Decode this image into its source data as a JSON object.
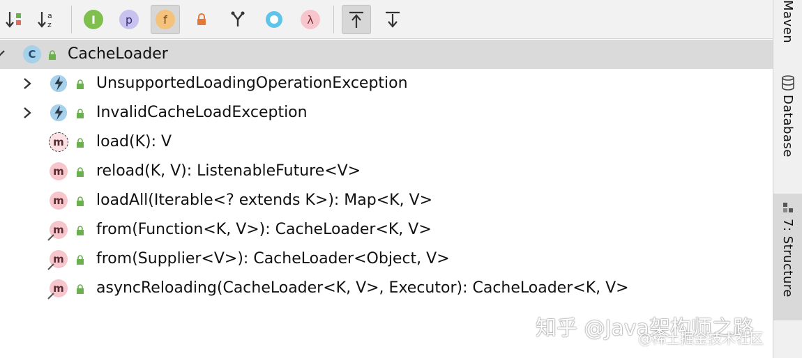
{
  "toolbar": {
    "buttons": [
      {
        "name": "sort-by-visibility-icon"
      },
      {
        "name": "sort-alphabetically-icon",
        "glyph_top": "a",
        "glyph_bottom": "z"
      },
      {
        "name": "show-inherited-icon",
        "glyph": "I"
      },
      {
        "name": "show-properties-icon",
        "glyph": "p"
      },
      {
        "name": "show-fields-icon",
        "glyph": "f"
      },
      {
        "name": "show-non-public-icon"
      },
      {
        "name": "show-anonymous-icon"
      },
      {
        "name": "show-lambdas-toggle-icon"
      },
      {
        "name": "show-lambdas-icon",
        "glyph": "λ"
      },
      {
        "name": "autoscroll-to-source-icon"
      },
      {
        "name": "autoscroll-from-source-icon"
      }
    ]
  },
  "tree": {
    "root": {
      "label": "CacheLoader",
      "icon": "class-icon",
      "icon_glyph": "C"
    },
    "items": [
      {
        "label": "UnsupportedLoadingOperationException",
        "icon": "exception-class-icon",
        "expandable": true
      },
      {
        "label": "InvalidCacheLoadException",
        "icon": "exception-class-icon",
        "expandable": true
      },
      {
        "label": "load(K): V",
        "icon": "abstract-method-icon",
        "icon_glyph": "m"
      },
      {
        "label": "reload(K, V): ListenableFuture<V>",
        "icon": "method-icon",
        "icon_glyph": "m"
      },
      {
        "label": "loadAll(Iterable<? extends K>): Map<K, V>",
        "icon": "method-icon",
        "icon_glyph": "m"
      },
      {
        "label": "from(Function<K, V>): CacheLoader<K, V>",
        "icon": "static-method-icon",
        "icon_glyph": "m"
      },
      {
        "label": "from(Supplier<V>): CacheLoader<Object, V>",
        "icon": "static-method-icon",
        "icon_glyph": "m"
      },
      {
        "label": "asyncReloading(CacheLoader<K, V>, Executor): CacheLoader<K, V>",
        "icon": "static-method-icon",
        "icon_glyph": "m"
      }
    ]
  },
  "sidebar": {
    "tabs": [
      {
        "label": "Maven"
      },
      {
        "label": "Database"
      },
      {
        "label": "7: Structure"
      }
    ]
  },
  "watermark": {
    "line1": "知乎 @Java架构师之路",
    "line2": "@稀土掘金技术社区"
  },
  "colors": {
    "method_icon_bg": "#f7c6cc",
    "lock_green": "#6ab04c",
    "selection": "#dadada",
    "toolbar_bg": "#f2f2f2"
  }
}
